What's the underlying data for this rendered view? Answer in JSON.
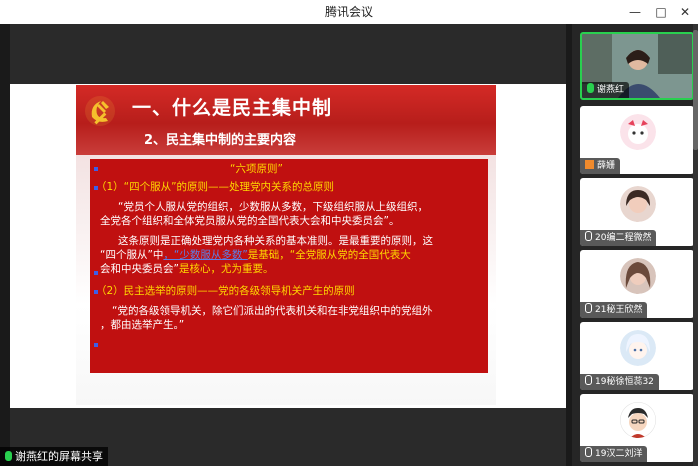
{
  "window": {
    "title": "腾讯会议",
    "min": "—",
    "max": "□",
    "close": "✕"
  },
  "slide": {
    "title": "一、什么是民主集中制",
    "subtitle": "2、民主集中制的主要内容",
    "lines": [
      "“六项原则”",
      "（1）“四个服从”的原则——处理党内关系的总原则",
      "“党员个人服从党的组织，少数服从多数，下级组织服从上级组织，",
      "全党各个组织和全体党员服从党的全国代表大会和中央委员会”。",
      "这条原则是正确处理党内各种关系的基本准则。是最重要的原则，这",
      "“四个服从”中",
      "，“少数服从多数”",
      "是基础，“全党服从党的全国代表大",
      "会和中央委员会”",
      "是核心，尤为重要。",
      "（2）民主选举的原则——党的各级领导机关产生的原则",
      "“党的各级领导机关，除它们派出的代表机关和在非党组织中的党组外",
      "，都由选举产生。”"
    ]
  },
  "participants": [
    {
      "name": "谢燕红",
      "mic": "active"
    },
    {
      "name": "薛姗",
      "mic": "user"
    },
    {
      "name": "20编二程微然",
      "mic": "muted"
    },
    {
      "name": "21秘王欣然",
      "mic": "muted"
    },
    {
      "name": "19秘徐恒蕊32",
      "mic": "muted"
    },
    {
      "name": "19汉二刘洋",
      "mic": "muted"
    }
  ],
  "share_label": "谢燕红的屏幕共享",
  "colors": {
    "accent_red": "#c01010",
    "highlight_yellow": "#ffd700",
    "mic_green": "#29d04f"
  }
}
